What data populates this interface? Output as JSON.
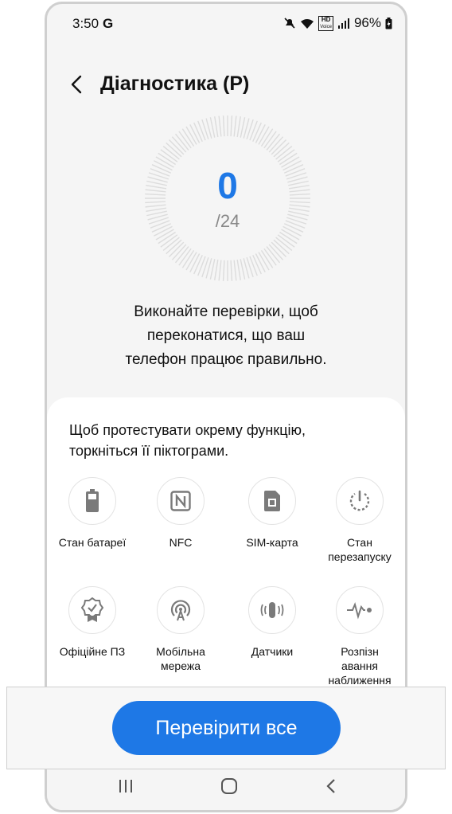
{
  "status_bar": {
    "time": "3:50",
    "google": "G",
    "hd_top": "HD",
    "hd_bottom": "Voice",
    "battery": "96%"
  },
  "header": {
    "title": "Діагностика (P)"
  },
  "dial": {
    "score": "0",
    "total": "/24"
  },
  "description": {
    "line1": "Виконайте перевірки, щоб",
    "line2": "переконатися, що ваш",
    "line3": "телефон працює правильно."
  },
  "card": {
    "hint_line1": "Щоб протестувати окрему функцію,",
    "hint_line2": "торкніться її піктограми."
  },
  "tests": [
    {
      "label_line1": "Стан батареї",
      "label_line2": "",
      "label_line3": "",
      "icon": "battery-icon"
    },
    {
      "label_line1": "NFC",
      "label_line2": "",
      "label_line3": "",
      "icon": "nfc-icon"
    },
    {
      "label_line1": "SIM-карта",
      "label_line2": "",
      "label_line3": "",
      "icon": "sim-card-icon"
    },
    {
      "label_line1": "Стан",
      "label_line2": "перезапуску",
      "label_line3": "",
      "icon": "restart-icon"
    },
    {
      "label_line1": "Офіційне ПЗ",
      "label_line2": "",
      "label_line3": "",
      "icon": "official-software-icon"
    },
    {
      "label_line1": "Мобільна",
      "label_line2": "мережа",
      "label_line3": "",
      "icon": "mobile-network-icon"
    },
    {
      "label_line1": "Датчики",
      "label_line2": "",
      "label_line3": "",
      "icon": "sensors-icon"
    },
    {
      "label_line1": "Розпізн",
      "label_line2": "авання",
      "label_line3": "наближення",
      "icon": "proximity-icon"
    }
  ],
  "cta": {
    "label": "Перевірити все"
  },
  "colors": {
    "accent": "#1e78e6",
    "background": "#f5f5f5",
    "card": "#ffffff"
  }
}
